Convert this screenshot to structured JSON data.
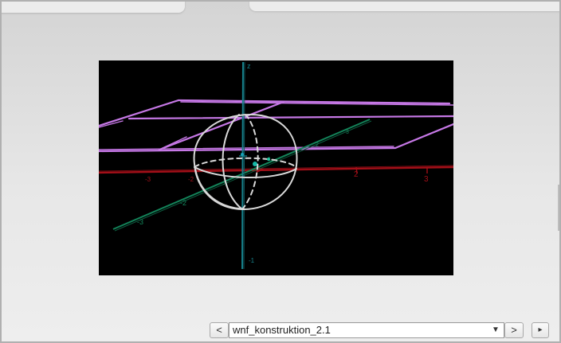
{
  "navigation": {
    "prev_label": "<",
    "next_label": ">",
    "play_label": "▸",
    "selected_slide": "wnf_konstruktion_2.1"
  },
  "canvas": {
    "axis_labels": {
      "z_top": "z",
      "z_bottom": "-1",
      "y_labels": [
        "-3",
        "-2",
        "-1",
        "1",
        "2",
        "3"
      ],
      "x_labels": [
        "-3",
        "-2",
        "-1",
        "1",
        "2",
        "3"
      ]
    }
  },
  "colors": {
    "plane": "#c678e6",
    "sphere": "#d9d9d9",
    "x_axis": "#a30f18",
    "y_axis": "#13845a",
    "z_axis": "#17808a",
    "canvas_bg": "#000000"
  }
}
